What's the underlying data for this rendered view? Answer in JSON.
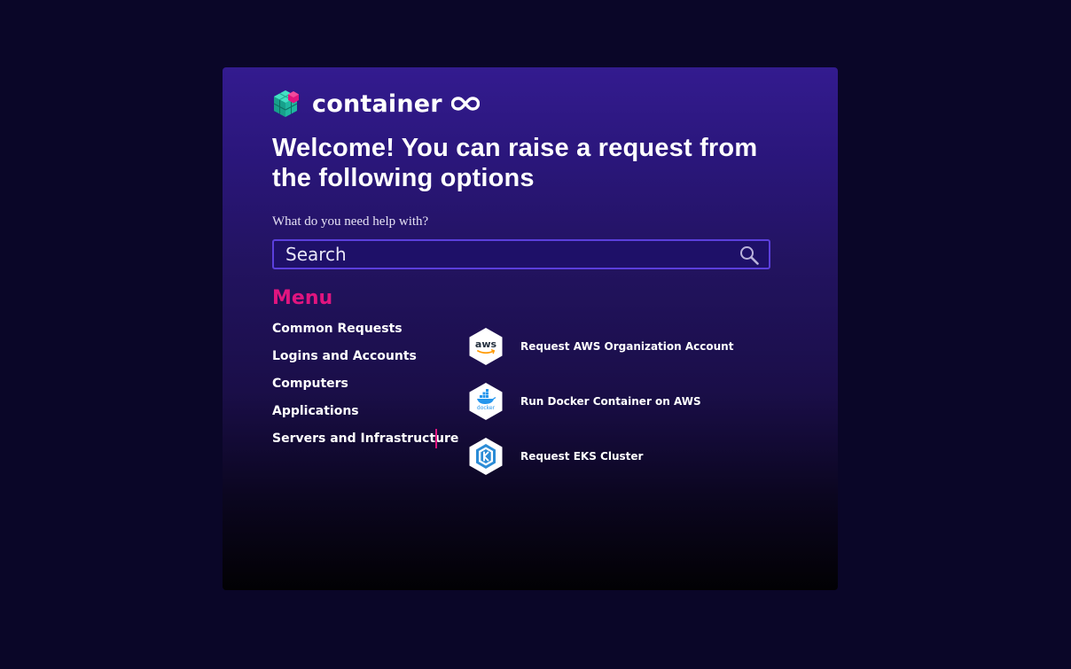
{
  "brand": {
    "name": "container",
    "logo_icon": "cube-logo-icon",
    "suffix_icon": "infinity-icon"
  },
  "heading": "Welcome! You can raise a request from the following options",
  "search": {
    "label": "What do you need help with?",
    "placeholder": "Search",
    "icon": "search-icon"
  },
  "menu": {
    "title": "Menu",
    "items": [
      {
        "label": "Common Requests"
      },
      {
        "label": "Logins and Accounts"
      },
      {
        "label": "Computers"
      },
      {
        "label": "Applications"
      },
      {
        "label": "Servers and Infrastructure",
        "active": true
      }
    ]
  },
  "options": [
    {
      "label": "Request AWS Organization Account",
      "icon": "aws-icon",
      "icon_text": "aws"
    },
    {
      "label": "Run Docker Container on AWS",
      "icon": "docker-icon",
      "icon_text": "docker"
    },
    {
      "label": "Request EKS Cluster",
      "icon": "eks-icon"
    }
  ],
  "colors": {
    "page_background": "#0a0628",
    "card_top": "#331b8f",
    "accent_pink": "#e0157f",
    "search_border": "#5b3fdc",
    "text": "#ffffff"
  }
}
